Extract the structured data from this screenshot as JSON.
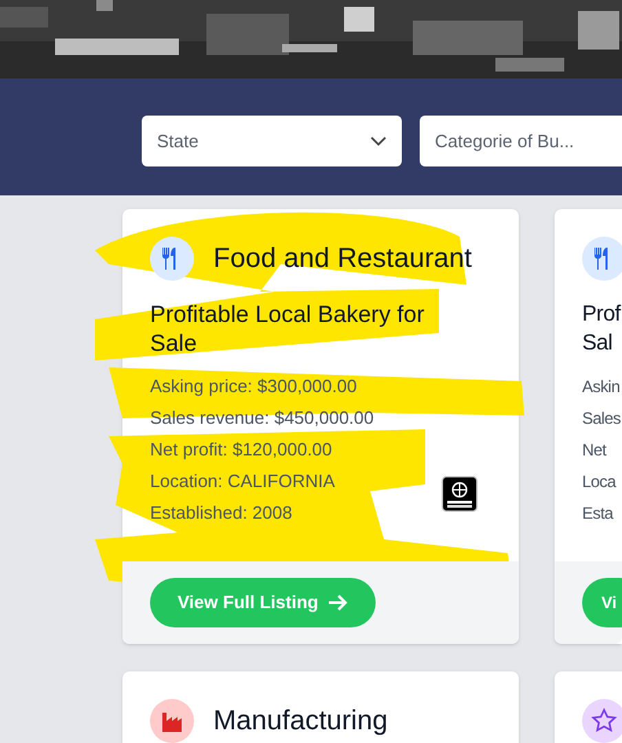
{
  "filters": [
    {
      "kind": "select",
      "placeholder": "State"
    },
    {
      "kind": "text",
      "placeholder": "Categorie of Bu..."
    }
  ],
  "listings": [
    {
      "kind": "food",
      "category": "Food and Restaurant",
      "title_lines": [
        "Profitable Local Bakery for",
        "Sale"
      ],
      "details": [
        "Asking price: $300,000.00",
        "Sales revenue: $450,000.00",
        "Net profit: $120,000.00",
        "Location: CALIFORNIA",
        "Established: 2008"
      ],
      "badge": true,
      "button": "View Full Listing",
      "highlighted": true
    },
    {
      "kind": "food",
      "title_lines": [
        "Prof",
        "Sal"
      ],
      "details": [
        "Askin",
        "Sales",
        "Net",
        "Loca",
        "Esta"
      ],
      "badge": false,
      "button": "Vi",
      "highlighted": false
    },
    {
      "kind": "factory",
      "category": "Manufacturing"
    },
    {
      "kind": "star"
    }
  ]
}
